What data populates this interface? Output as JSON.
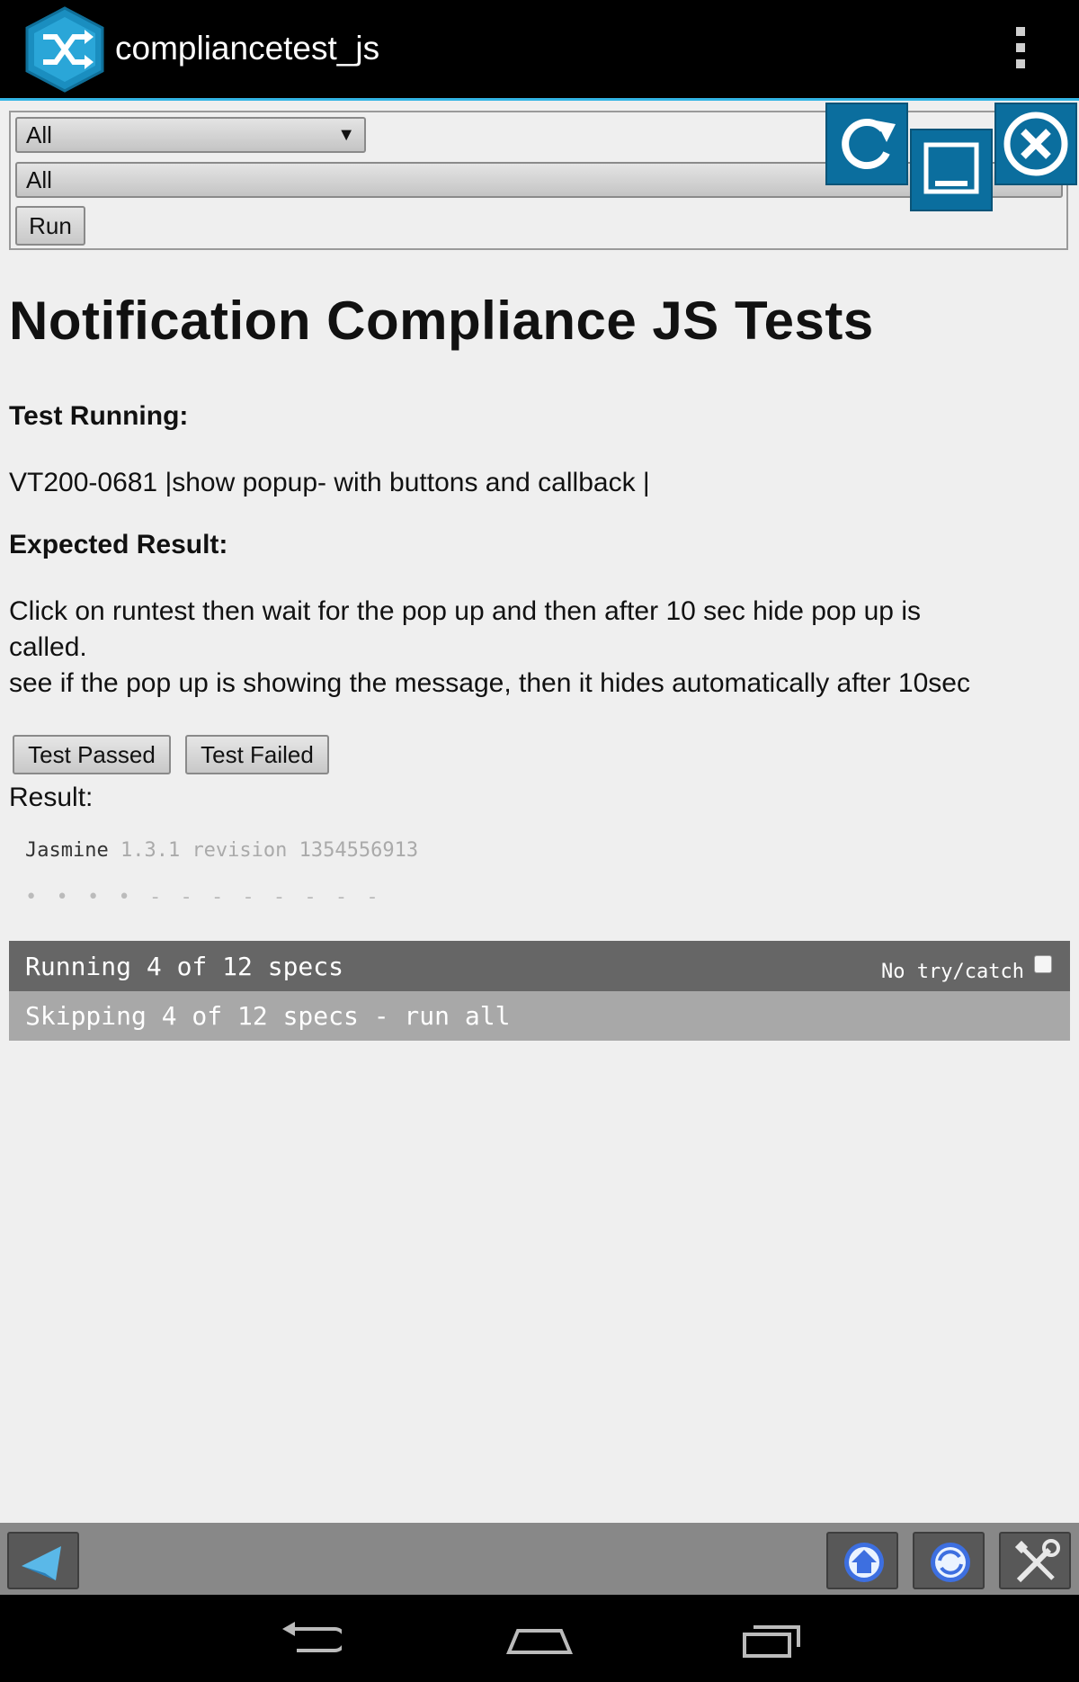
{
  "app": {
    "title": "compliancetest_js"
  },
  "filters": {
    "select_1": "All",
    "select_2": "All",
    "run_label": "Run"
  },
  "content": {
    "title": "Notification Compliance JS Tests",
    "test_running_label": "Test Running:",
    "test_name": "VT200-0681 |show popup- with buttons and callback |",
    "expected_label": "Expected Result:",
    "expected_line1": "Click on runtest then wait for the pop up and then after 10 sec hide pop up is",
    "expected_line2": "called.",
    "expected_line3": "see if the pop up is showing the message, then it hides automatically after 10sec",
    "passed_label": "Test Passed",
    "failed_label": "Test Failed",
    "result_label": "Result:"
  },
  "jasmine": {
    "name": "Jasmine",
    "version": "1.3.1 revision 1354556913",
    "dots": "• • • • - - - - - - - -",
    "running": "Running 4 of 12 specs",
    "no_try_catch": "No try/catch",
    "skipping": "Skipping 4 of 12 specs - run all"
  },
  "icons": {
    "app": "shuffle-icon",
    "overflow": "overflow-menu-icon",
    "refresh": "refresh-icon",
    "minimize": "minimize-icon",
    "close": "close-icon",
    "back": "back-arrow-icon",
    "home": "home-icon",
    "sync": "sync-icon",
    "tools": "tools-icon"
  },
  "colors": {
    "accent": "#33b5e5",
    "control_blue": "#0b6e9e",
    "running_bar": "#666666",
    "skipping_bar": "#a8a8a8"
  }
}
